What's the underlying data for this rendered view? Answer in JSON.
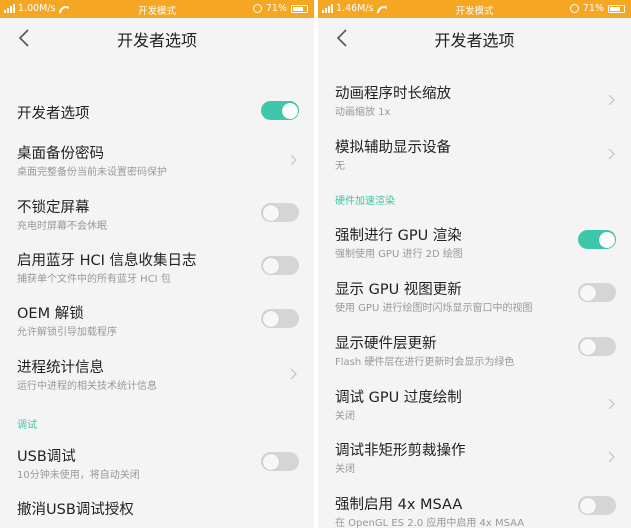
{
  "colors": {
    "statusbar": "#f5a623",
    "accent": "#3ec7a8",
    "background": "#f4f4f4",
    "toggle_off": "#d5d5d5"
  },
  "left": {
    "statusbar": {
      "speed": "1.00M/s",
      "mode": "开发模式",
      "battery": "71%"
    },
    "title": "开发者选项",
    "items": [
      {
        "title": "开发者选项",
        "control": "toggle",
        "on": true
      },
      {
        "title": "桌面备份密码",
        "subtitle": "桌面完整备份当前未设置密码保护",
        "control": "chevron"
      },
      {
        "title": "不锁定屏幕",
        "subtitle": "充电时屏幕不会休眠",
        "control": "toggle",
        "on": false
      },
      {
        "title": "启用蓝牙 HCI 信息收集日志",
        "subtitle": "捕获单个文件中的所有蓝牙 HCI 包",
        "control": "toggle",
        "on": false
      },
      {
        "title": "OEM 解锁",
        "subtitle": "允许解锁引导加载程序",
        "control": "toggle",
        "on": false
      },
      {
        "title": "进程统计信息",
        "subtitle": "运行中进程的相关技术统计信息",
        "control": "chevron"
      }
    ],
    "section_debug": "调试",
    "items_debug": [
      {
        "title": "USB调试",
        "subtitle": "10分钟未使用，将自动关闭",
        "control": "toggle",
        "on": false
      },
      {
        "title": "撤消USB调试授权"
      }
    ]
  },
  "right": {
    "statusbar": {
      "speed": "1.46M/s",
      "mode": "开发模式",
      "battery": "71%"
    },
    "title": "开发者选项",
    "items_top": [
      {
        "title": "动画程序时长缩放",
        "subtitle": "动画缩放 1x",
        "control": "chevron"
      },
      {
        "title": "模拟辅助显示设备",
        "subtitle": "无",
        "control": "chevron"
      }
    ],
    "section_hw": "硬件加速渲染",
    "items_hw": [
      {
        "title": "强制进行 GPU 渲染",
        "subtitle": "强制使用 GPU 进行 2D 绘图",
        "control": "toggle",
        "on": true
      },
      {
        "title": "显示 GPU 视图更新",
        "subtitle": "使用 GPU 进行绘图时闪烁显示窗口中的视图",
        "control": "toggle",
        "on": false
      },
      {
        "title": "显示硬件层更新",
        "subtitle": "Flash 硬件层在进行更新时会显示为绿色",
        "control": "toggle",
        "on": false
      },
      {
        "title": "调试 GPU 过度绘制",
        "subtitle": "关闭",
        "control": "chevron"
      },
      {
        "title": "调试非矩形剪裁操作",
        "subtitle": "关闭",
        "control": "chevron"
      },
      {
        "title": "强制启用 4x MSAA",
        "subtitle": "在 OpenGL ES 2.0 应用中启用 4x MSAA",
        "control": "toggle",
        "on": false
      }
    ]
  }
}
